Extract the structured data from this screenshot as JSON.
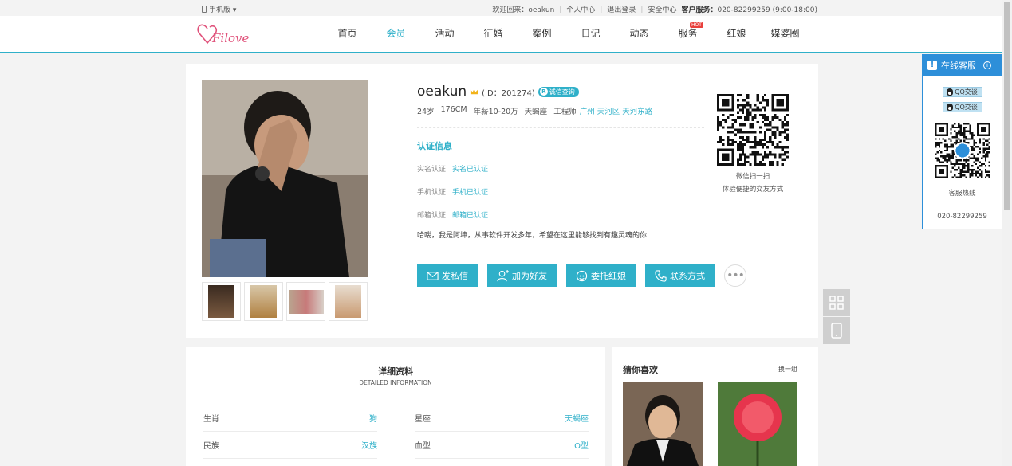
{
  "topbar": {
    "mobile_label": "手机版 ▾",
    "welcome": "欢迎回来：oeakun",
    "links": [
      "个人中心",
      "退出登录",
      "安全中心"
    ],
    "service_label": "客户服务：",
    "service_phone": "020-82299259 (9:00-18:00)"
  },
  "header": {
    "logo_text": "Filove",
    "nav": [
      {
        "label": "首页",
        "active": false
      },
      {
        "label": "会员",
        "active": true
      },
      {
        "label": "活动",
        "active": false
      },
      {
        "label": "征婚",
        "active": false
      },
      {
        "label": "案例",
        "active": false
      },
      {
        "label": "日记",
        "active": false
      },
      {
        "label": "动态",
        "active": false
      },
      {
        "label": "服务",
        "active": false,
        "badge": "HOT"
      },
      {
        "label": "红娘",
        "active": false
      },
      {
        "label": "媒婆圈",
        "active": false
      }
    ]
  },
  "profile": {
    "name": "oeakun",
    "uid": "(ID：201274)",
    "credit_label": "诚信查询",
    "basic": [
      "24岁",
      "176CM",
      "年薪10-20万",
      "天蝎座",
      "工程师"
    ],
    "location": [
      "广州",
      "天河区",
      "天河东路"
    ],
    "cert_title": "认证信息",
    "certs": [
      {
        "label": "实名认证",
        "value": "实名已认证"
      },
      {
        "label": "手机认证",
        "value": "手机已认证"
      },
      {
        "label": "邮箱认证",
        "value": "邮箱已认证"
      }
    ],
    "intro": "哈喽，我是阿坤，从事软件开发多年，希望在这里能够找到有趣灵魂的你",
    "actions": [
      "发私信",
      "加为好友",
      "委托红娘",
      "联系方式"
    ],
    "more": "•••",
    "qr_text1": "微信扫一扫",
    "qr_text2": "体验便捷的交友方式"
  },
  "detail": {
    "title": "详细资料",
    "subtitle": "DETAILED INFORMATION",
    "rows": [
      {
        "label": "生肖",
        "value": "狗"
      },
      {
        "label": "星座",
        "value": "天蝎座"
      },
      {
        "label": "民族",
        "value": "汉族"
      },
      {
        "label": "血型",
        "value": "O型"
      }
    ]
  },
  "like": {
    "title": "猜你喜欢",
    "switch": "换一组"
  },
  "service": {
    "title": "在线客服",
    "qq": [
      "QQ交谈",
      "QQ交谈"
    ],
    "hotline_label": "客服热线",
    "hotline": "020-82299259"
  },
  "colors": {
    "accent": "#2fb0c9",
    "service_blue": "#2d8fd9",
    "hot": "#e8403c"
  }
}
